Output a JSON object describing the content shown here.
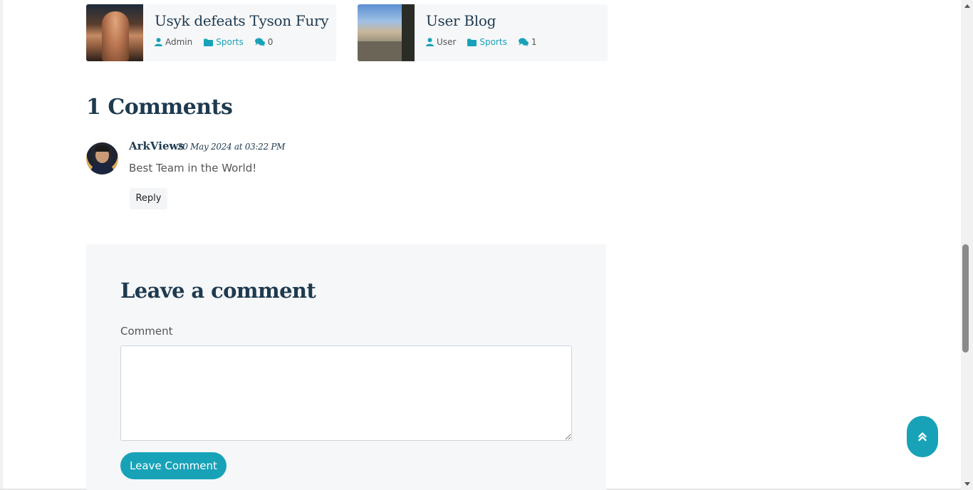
{
  "related_posts": [
    {
      "title": "Usyk defeats Tyson Fury",
      "author": "Admin",
      "category": "Sports",
      "comment_count": "0"
    },
    {
      "title": "User Blog",
      "author": "User",
      "category": "Sports",
      "comment_count": "1"
    }
  ],
  "comments": {
    "heading": "1 Comments",
    "items": [
      {
        "author": "ArkViews",
        "date": "20 May 2024 at 03:22 PM",
        "text": "Best Team in the World!",
        "reply_label": "Reply"
      }
    ]
  },
  "leave_comment": {
    "heading": "Leave a comment",
    "field_label": "Comment",
    "field_value": "",
    "submit_label": "Leave Comment"
  },
  "colors": {
    "accent": "#17a2b8",
    "heading": "#1e3a4f",
    "panel": "#f6f7f9"
  },
  "icons": {
    "author": "user-icon",
    "category": "folder-icon",
    "comments": "comments-icon",
    "back_to_top": "double-chevron-up-icon"
  }
}
